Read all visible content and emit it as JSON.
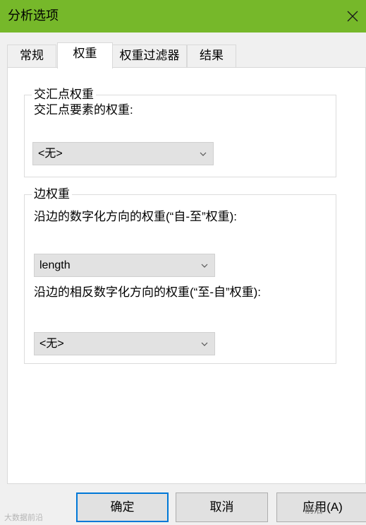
{
  "window": {
    "title": "分析选项",
    "close_icon": "close-icon",
    "accent_color": "#76b82a"
  },
  "tabs": [
    {
      "label": "常规",
      "active": false
    },
    {
      "label": "权重",
      "active": true
    },
    {
      "label": "权重过滤器",
      "active": false
    },
    {
      "label": "结果",
      "active": false
    }
  ],
  "junction_group": {
    "legend": "交汇点权重",
    "field_label": "交汇点要素的权重:",
    "selected": "<无>"
  },
  "edge_group": {
    "legend": "边权重",
    "from_to_label": "沿边的数字化方向的权重(“自-至”权重):",
    "from_to_selected": "length",
    "to_from_label": "沿边的相反数字化方向的权重(“至-自”权重):",
    "to_from_selected": "<无>"
  },
  "buttons": {
    "ok": "确定",
    "cancel": "取消",
    "apply": "应用(A)"
  },
  "watermarks": {
    "left": "大数据前沿",
    "right": "前沿"
  }
}
